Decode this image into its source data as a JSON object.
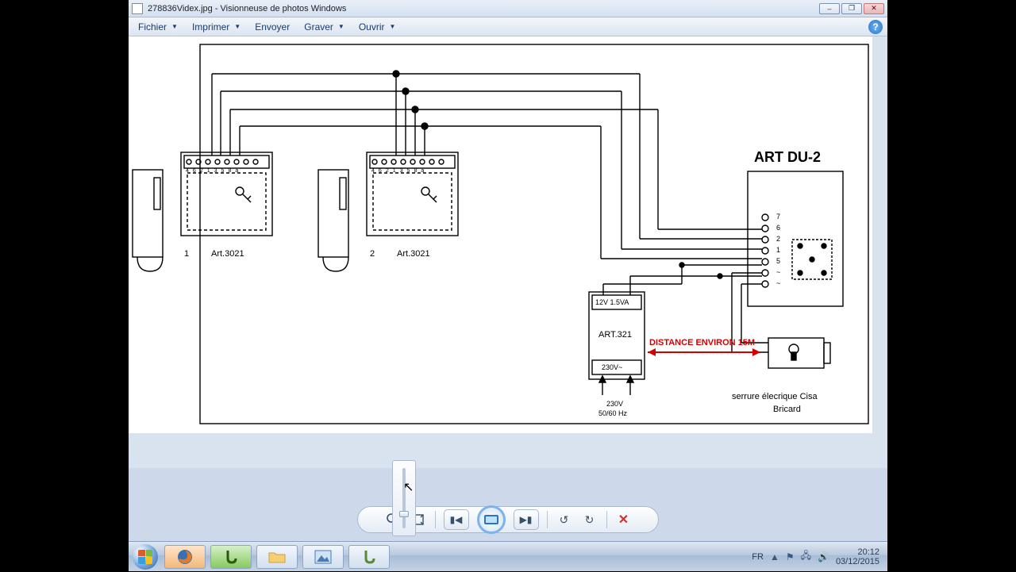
{
  "window": {
    "title": "278836Videx.jpg - Visionneuse de photos Windows",
    "buttons": {
      "min": "–",
      "max": "❐",
      "close": "✕"
    }
  },
  "menu": {
    "file": "Fichier",
    "print": "Imprimer",
    "email": "Envoyer",
    "burn": "Graver",
    "open": "Ouvrir"
  },
  "diagram": {
    "unit1_num": "1",
    "unit1_model": "Art.3021",
    "unit2_num": "2",
    "unit2_model": "Art.3021",
    "du2_title": "ART DU-2",
    "psu_top": "12V 1.5VA",
    "psu_model": "ART.321",
    "psu_bottom": "230V~",
    "psu_mains1": "230V",
    "psu_mains2": "50/60 Hz",
    "distance": "DISTANCE ENVIRON 15M",
    "lock1": "serrure élecrique Cisa",
    "lock2": "Bricard",
    "du2_terms": {
      "t7": "7",
      "t6": "6",
      "t2": "2",
      "t1": "1",
      "t5": "5",
      "tac1": "~",
      "tac2": "~"
    },
    "unit_terms": {
      "a": "4",
      "b": "6",
      "c": "2",
      "d": "1",
      "e": "3",
      "f": "5",
      "g": "8",
      "h": "a"
    }
  },
  "tray": {
    "lang": "FR",
    "time": "20:12",
    "date": "03/12/2015"
  }
}
